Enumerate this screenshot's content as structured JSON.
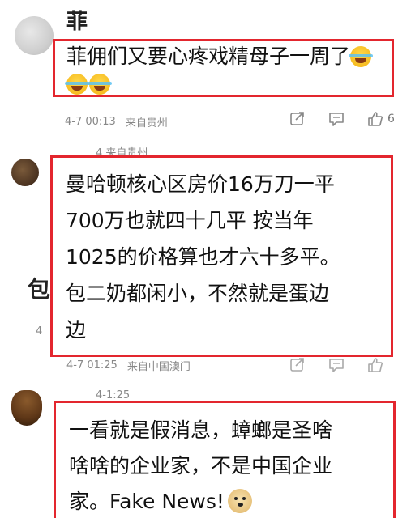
{
  "fragments": {
    "top_cut": "菲",
    "left_cut": "包",
    "left_num": "4"
  },
  "comments": [
    {
      "text": "菲佣们又要心疼戏精母子一周了",
      "emoji": [
        "laugh-cry-emoji",
        "laugh-cry-emoji",
        "laugh-cry-emoji"
      ],
      "date": "4-7 00:13",
      "location": "来自贵州",
      "likes": "6"
    },
    {
      "reply_hint": "4 来自贵州",
      "lines": [
        "曼哈顿核心区房价16万刀一平",
        "700万也就四十几平 按当年",
        "1025的价格算也才六十多平。",
        "包二奶都闲小，不然就是蛋边",
        "边"
      ],
      "date": "4-7 01:25",
      "location": "来自中国澳门"
    },
    {
      "reply_hint": "4-1:25",
      "lines": [
        "一看就是假消息，蟑螂是圣啥",
        "啥啥的企业家，不是中国企业",
        "家。Fake News!"
      ],
      "emoji": "doge-emoji"
    }
  ],
  "icons": {
    "share": "share-icon",
    "comment": "comment-icon",
    "like": "thumbs-up-icon"
  },
  "colors": {
    "highlight_border": "#e3262e",
    "meta_text": "#888888"
  }
}
